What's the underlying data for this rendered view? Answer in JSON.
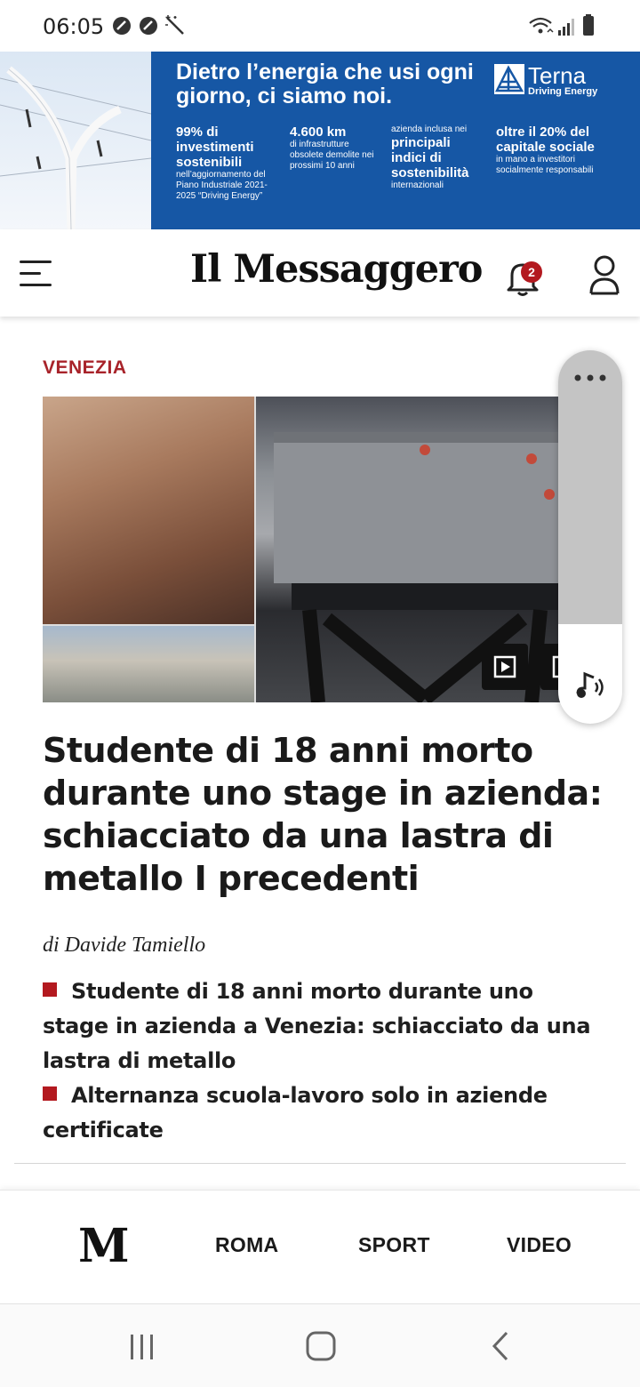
{
  "status_bar": {
    "time": "06:05",
    "left_icons": [
      "whatsapp-icon",
      "whatsapp-icon",
      "magic-wand-icon"
    ],
    "right_icons": [
      "wifi-icon",
      "signal-icon",
      "battery-icon"
    ]
  },
  "ad": {
    "headline": "Dietro l’energia che usi ogni giorno, ci siamo noi.",
    "brand_name": "Terna",
    "brand_tagline": "Driving Energy",
    "col1_big": "99% di investimenti sostenibili",
    "col1_small": "nell’aggiornamento del Piano Industriale 2021-2025 “Driving Energy”",
    "col2_big": "4.600 km",
    "col2_small": "di infrastrutture obsolete demolite nei prossimi 10 anni",
    "col3_small_top": "azienda inclusa nei",
    "col3_big": "principali indici di sostenibilità",
    "col3_small": "internazionali",
    "col4_big": "oltre il 20% del capitale sociale",
    "col4_small": "in mano a investitori socialmente responsabili"
  },
  "header": {
    "masthead": "Il Messaggero",
    "notification_count": "2",
    "icons": [
      "menu-icon",
      "bell-icon",
      "user-icon"
    ]
  },
  "article": {
    "section": "VENEZIA",
    "title": "Studente di 18 anni morto durante uno stage in azienda: schiacciato da una lastra di metallo I precedenti",
    "byline": "di Davide Tamiello",
    "related": [
      "Studente di 18 anni morto durante uno stage in azienda a Venezia: schiacciato da una lastra di metallo",
      "Alternanza scuola-lavoro solo in aziende certificate"
    ]
  },
  "tts": {
    "icons": [
      "more-options-icon",
      "audio-speaker-icon"
    ]
  },
  "bottom_nav": {
    "logo": "M",
    "links": [
      "ROMA",
      "SPORT",
      "VIDEO"
    ]
  },
  "colors": {
    "accent_red": "#a8232a",
    "ad_blue": "#1657a5",
    "text": "#1a1a1a"
  }
}
